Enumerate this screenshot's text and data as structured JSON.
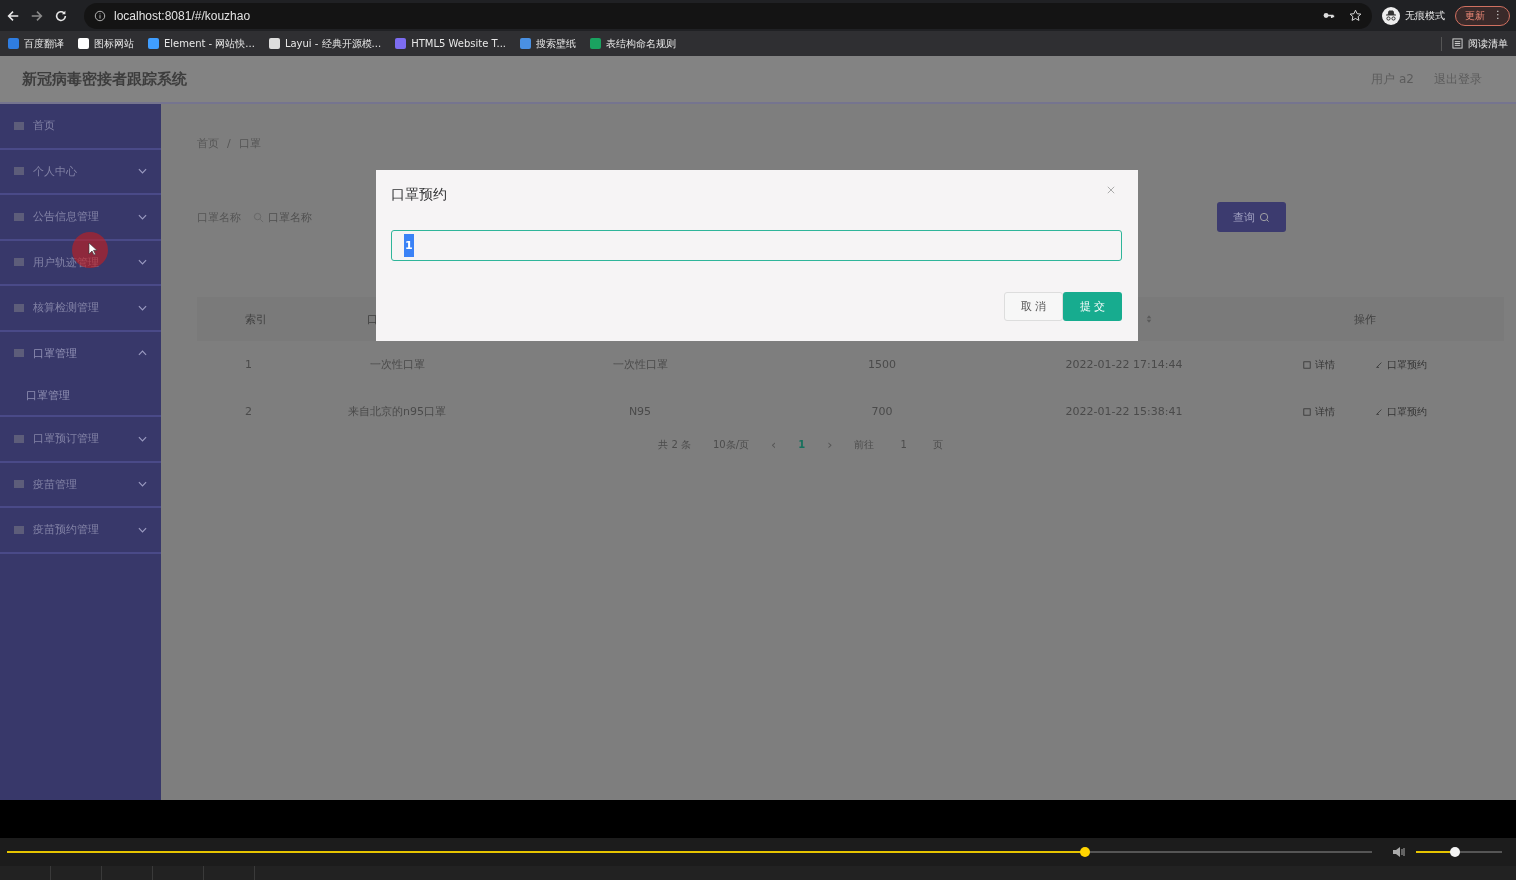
{
  "browser": {
    "url": "localhost:8081/#/kouzhao",
    "profile_label": "无痕模式",
    "update_button": "更新",
    "menu_glyph": "⋮",
    "bookmarks": [
      {
        "label": "百度翻译",
        "color": "#2f7de1"
      },
      {
        "label": "图标网站",
        "color": "#ffffff"
      },
      {
        "label": "Element - 网站快...",
        "color": "#409eff"
      },
      {
        "label": "Layui - 经典开源模...",
        "color": "#dddddd"
      },
      {
        "label": "HTML5 Website T...",
        "color": "#7c6cf0"
      },
      {
        "label": "搜索壁纸",
        "color": "#4a90e2"
      },
      {
        "label": "表结构命名规则",
        "color": "#1aa260"
      }
    ],
    "reading_list": "阅读清单"
  },
  "header": {
    "title": "新冠病毒密接者跟踪系统",
    "user": "用户 a2",
    "logout": "退出登录"
  },
  "sidebar": {
    "items": [
      {
        "kind": "link",
        "label": "首页"
      },
      {
        "kind": "submenu",
        "label": "个人中心",
        "expanded": false
      },
      {
        "kind": "submenu",
        "label": "公告信息管理",
        "expanded": false
      },
      {
        "kind": "submenu",
        "label": "用户轨迹管理",
        "expanded": false
      },
      {
        "kind": "submenu",
        "label": "核算检测管理",
        "expanded": false
      },
      {
        "kind": "submenu",
        "label": "口罩管理",
        "expanded": true,
        "children": [
          {
            "label": "口罩管理"
          }
        ]
      },
      {
        "kind": "submenu",
        "label": "口罩预订管理",
        "expanded": false
      },
      {
        "kind": "submenu",
        "label": "疫苗管理",
        "expanded": false
      },
      {
        "kind": "submenu",
        "label": "疫苗预约管理",
        "expanded": false
      }
    ]
  },
  "breadcrumb": {
    "items": [
      "首页",
      "口罩"
    ],
    "separator": "/"
  },
  "search": {
    "label": "口罩名称",
    "placeholder": "口罩名称",
    "button": "查询"
  },
  "table": {
    "columns": [
      "索引",
      "口",
      "",
      "",
      "",
      "操作"
    ],
    "rows": [
      {
        "cells": [
          "1",
          "一次性口罩",
          "一次性口罩",
          "1500",
          "2022-01-22 17:14:44"
        ],
        "actions": [
          "详情",
          "口罩预约"
        ]
      },
      {
        "cells": [
          "2",
          "来自北京的n95口罩",
          "N95",
          "700",
          "2022-01-22 15:38:41"
        ],
        "actions": [
          "详情",
          "口罩预约"
        ]
      }
    ]
  },
  "pagination": {
    "total": "共 2 条",
    "page_size": "10条/页",
    "prev": "‹",
    "next": "›",
    "pages": [
      {
        "label": "1",
        "selected": true
      }
    ],
    "goto_label": "前往",
    "goto_value": "1",
    "goto_suffix": "页"
  },
  "dialog": {
    "title": "口罩预约",
    "value": "1",
    "cancel": "取 消",
    "submit": "提 交"
  },
  "player": {
    "progress": {
      "level": 0.79
    },
    "volume": {
      "level": 0.45
    }
  }
}
